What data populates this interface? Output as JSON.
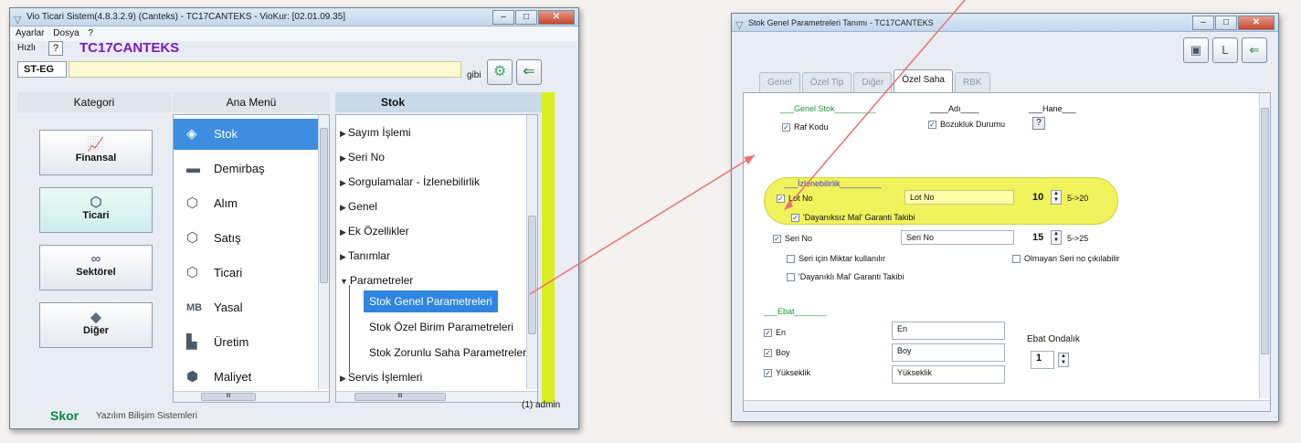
{
  "left_window": {
    "title": "Vio Ticari Sistem(4.8.3.2.9) (Canteks) - TC17CANTEKS - VioKur: [02.01.09.35]",
    "menubar": [
      "Ayarlar",
      "Dosya",
      "?"
    ],
    "hizli_label": "Hızlı",
    "help_label": "?",
    "company": "TC17CANTEKS",
    "code_value": "ST-EG",
    "gibi_label": "gibi",
    "column_headers": {
      "kategori": "Kategori",
      "ana_menu": "Ana Menü",
      "stok": "Stok"
    },
    "kategori": [
      {
        "label": "Finansal",
        "icon": "chart-icon"
      },
      {
        "label": "Ticari",
        "icon": "box-icon"
      },
      {
        "label": "Sektörel",
        "icon": "rings-icon"
      },
      {
        "label": "Diğer",
        "icon": "diamond-icon"
      }
    ],
    "ana_menu": [
      {
        "label": "Stok",
        "icon": "cube-icon"
      },
      {
        "label": "Demirbaş",
        "icon": "bed-icon"
      },
      {
        "label": "Alım",
        "icon": "box-icon"
      },
      {
        "label": "Satış",
        "icon": "box-icon"
      },
      {
        "label": "Ticari",
        "icon": "box-icon"
      },
      {
        "label": "Yasal",
        "icon": "mb-icon"
      },
      {
        "label": "Üretim",
        "icon": "factory-icon"
      },
      {
        "label": "Maliyet",
        "icon": "boxes-icon"
      }
    ],
    "stok_tree": [
      "Sayım İşlemi",
      "Seri No",
      "Sorgulamalar - İzlenebilirlik",
      "Genel",
      "Ek Özellikler",
      "Tanımlar",
      "Parametreler"
    ],
    "stok_sub": [
      "Stok Genel Parametreleri",
      "Stok Özel Birim Parametreleri",
      "Stok Zorunlu Saha Parametreleri"
    ],
    "servis": "Servis İşlemleri",
    "scroll_marker": "III",
    "footer": {
      "brand": "Skor",
      "subtitle": "Yazılım Bilişim Sistemleri",
      "user": "(1) admin"
    }
  },
  "right_window": {
    "title": "Stok Genel Parametreleri Tanımı - TC17CANTEKS",
    "tabs": [
      "Genel",
      "Özel Tip",
      "Diğer",
      "Özel Saha",
      "RBK"
    ],
    "active_tab": "Özel Saha",
    "headers": {
      "genel_stok": "___Genel Stok_________",
      "adi": "____Adı____",
      "hane": "___Hane___"
    },
    "raf_kodu": "Raf Kodu",
    "bozukluk": "Bozukluk Durumu",
    "help_label": "?",
    "izlenebilirlik": "___İzlenebilirlik_________",
    "lot_no": {
      "label": "Lot No",
      "value": "Lot No",
      "hane": "10",
      "range": "5->20"
    },
    "dayaniksiz": "'Dayanıksız Mal' Garanti Takibi",
    "seri_no": {
      "label": "Seri No",
      "value": "Seri No",
      "hane": "15",
      "range": "5->25"
    },
    "seri_miktar": "Seri için Miktar kullanılır",
    "olmayan_seri": "Olmayan Seri no çıkılabilir",
    "dayanikli": "'Dayanıklı Mal' Garanti Takibi",
    "ebat": "___Ebat_______",
    "en": {
      "label": "En",
      "value": "En"
    },
    "boy": {
      "label": "Boy",
      "value": "Boy"
    },
    "yukseklik": {
      "label": "Yükseklik",
      "value": "Yükseklik"
    },
    "ebat_ondalik": {
      "label": "Ebat Ondalık",
      "value": "1"
    }
  },
  "colors": {
    "accent": "#3d8ee0",
    "brand_purple": "#7a18c9",
    "skor_green": "#0a8a3a",
    "highlight_yellow": "#f1f25c",
    "arrow": "#f07070"
  }
}
